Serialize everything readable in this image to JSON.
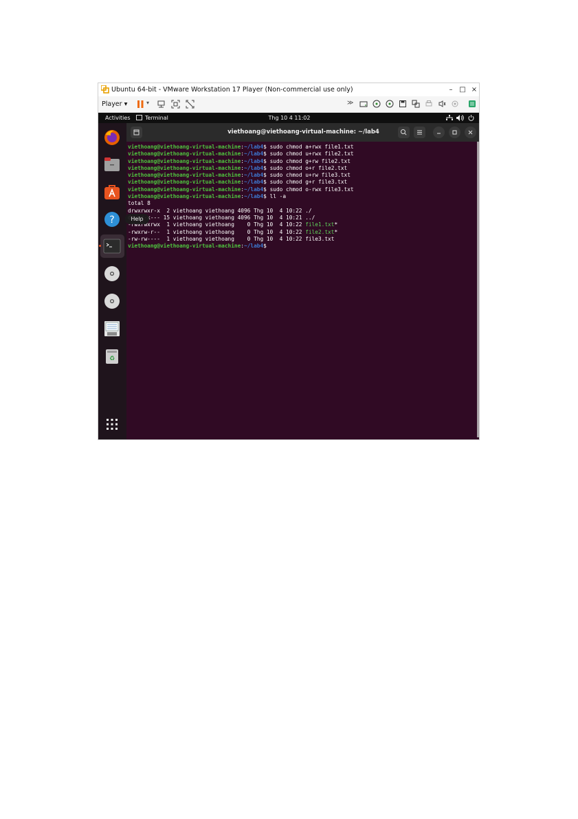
{
  "vmware": {
    "title": "Ubuntu 64-bit - VMware Workstation 17 Player (Non-commercial use only)",
    "player_menu": "Player",
    "window_controls": {
      "minimize": "–",
      "maximize": "□",
      "close": "×"
    }
  },
  "ubuntu": {
    "topbar": {
      "activities": "Activities",
      "app_name": "Terminal",
      "clock": "Thg 10 4  11:02"
    },
    "dock": {
      "tooltip": "Help",
      "items": [
        "firefox-icon",
        "files-icon",
        "app-center-icon",
        "help-icon",
        "terminal-icon",
        "disc-icon",
        "disc-icon",
        "floppy-icon",
        "trash-icon",
        "app-grid-icon"
      ]
    },
    "terminal": {
      "title": "viethoang@viethoang-virtual-machine: ~/lab4",
      "prompt_user": "viethoang@viethoang-virtual-machine",
      "prompt_sep": ":",
      "prompt_path": "~/lab4",
      "prompt_dollar": "$",
      "commands": [
        " sudo chmod a+rwx file1.txt",
        " sudo chmod u+rwx file2.txt",
        " sudo chmod g+rw file2.txt",
        " sudo chmod o+r file2.txt",
        " sudo chmod u+rw file3.txt",
        " sudo chmod g+r file3.txt",
        " sudo chmod o-rwx file3.txt",
        " ll -a"
      ],
      "total": "total 8",
      "listing": [
        {
          "meta": "drwxrwxr-x  2 viethoang viethoang 4096 Thg 10  4 10:22 ",
          "name": "./",
          "suffix": "",
          "exec": false
        },
        {
          "meta": "drwxr-x--- 15 viethoang viethoang 4096 Thg 10  4 10:21 ",
          "name": "../",
          "suffix": "",
          "exec": false
        },
        {
          "meta": "-rwxrwxrwx  1 viethoang viethoang    0 Thg 10  4 10:22 ",
          "name": "file1.txt",
          "suffix": "*",
          "exec": true
        },
        {
          "meta": "-rwxrw-r--  1 viethoang viethoang    0 Thg 10  4 10:22 ",
          "name": "file2.txt",
          "suffix": "*",
          "exec": true
        },
        {
          "meta": "-rw-rw----  1 viethoang viethoang    0 Thg 10  4 10:22 ",
          "name": "file3.txt",
          "suffix": "",
          "exec": false
        }
      ]
    }
  }
}
